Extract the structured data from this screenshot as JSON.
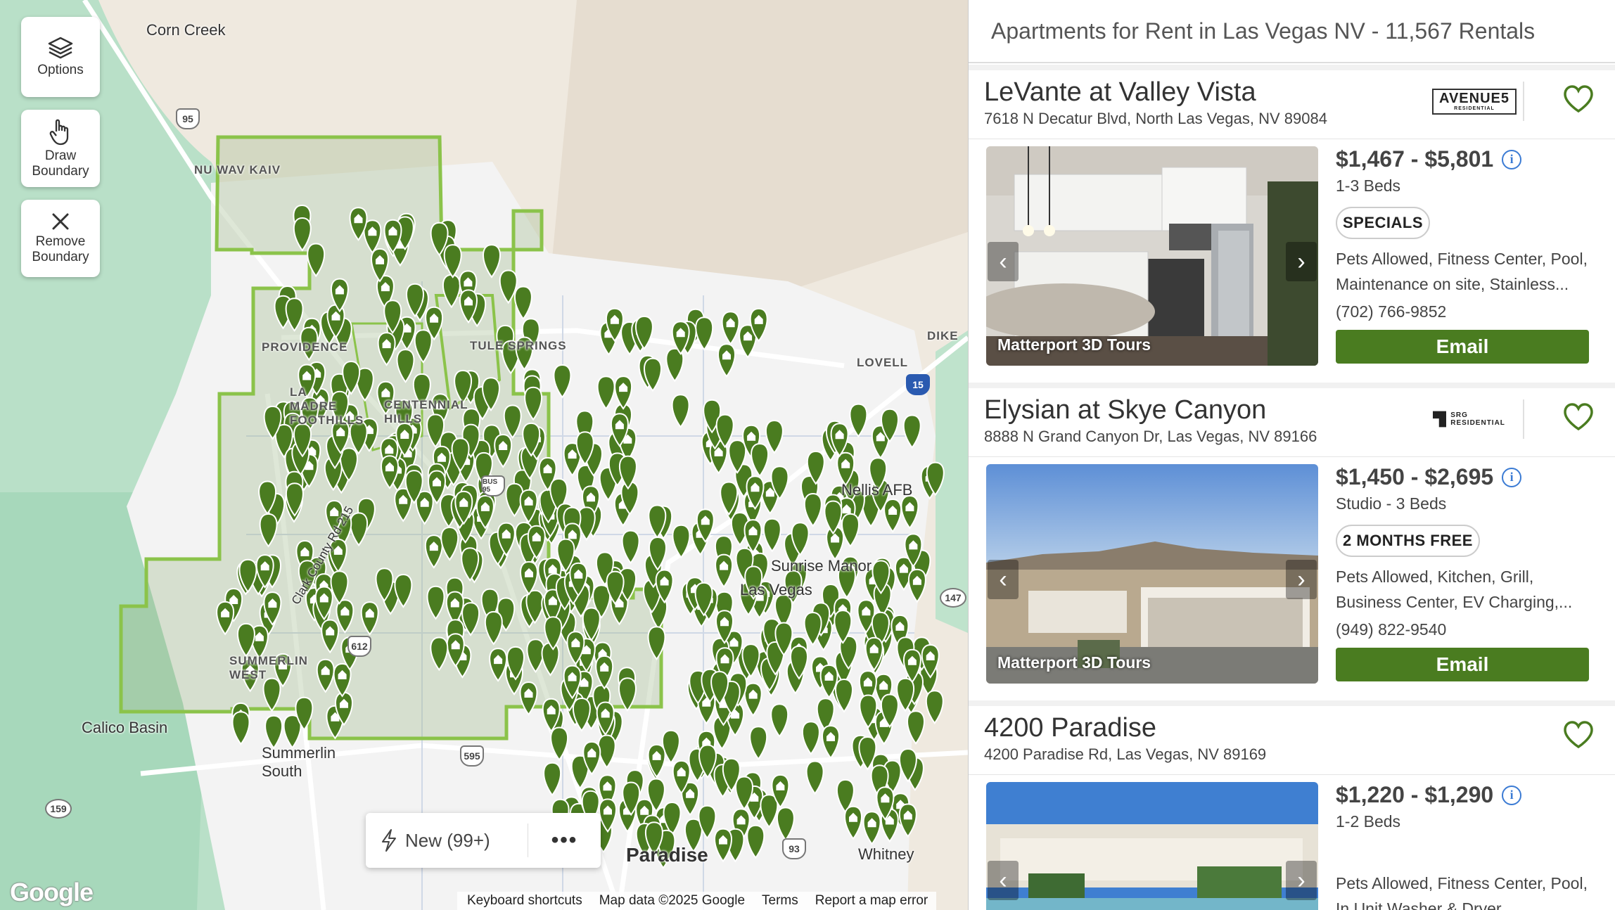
{
  "map": {
    "buttons": {
      "options": "Options",
      "draw_boundary": "Draw Boundary",
      "remove_boundary": "Remove Boundary"
    },
    "places": {
      "corn_creek": "Corn Creek",
      "nu_wav_kaiv": "NU WAV KAIV",
      "tule_springs": "TULE SPRINGS",
      "dike": "DIKE",
      "lovell": "LOVELL",
      "providence": "PROVIDENCE",
      "centennial": "CENTENNIAL HILLS",
      "la_madre": "LA MADRE FOOTHILLS",
      "nellis": "Nellis AFB",
      "sunrise_manor": "Sunrise Manor",
      "las_vegas": "Las Vegas",
      "calico_basin": "Calico Basin",
      "summerlin_west": "SUMMERLIN WEST",
      "summerlin_south": "Summerlin South",
      "paradise": "Paradise",
      "whitney": "Whitney",
      "clark_county": "Clark County Rd 215"
    },
    "highways": [
      "95",
      "15",
      "147",
      "159",
      "612",
      "595",
      "93",
      "BUS 95"
    ],
    "pill": {
      "new_label": "New (99+)",
      "more_label": "•••"
    },
    "google_logo": "Google",
    "footer": {
      "shortcuts": "Keyboard shortcuts",
      "map_data": "Map data ©2025 Google",
      "terms": "Terms",
      "report": "Report a map error"
    },
    "colors": {
      "boundary": "#8bc34a",
      "pin": "#4a7c20"
    }
  },
  "panel": {
    "heading": "Apartments for Rent in Las Vegas NV - 11,567 Rentals",
    "listings": [
      {
        "name": "LeVante at Valley Vista",
        "address": "7618 N Decatur Blvd, North Las Vegas, NV 89084",
        "logo": "AVENUE5",
        "logo_sub": "RESIDENTIAL",
        "price": "$1,467 - $5,801",
        "beds": "1-3 Beds",
        "badge": "SPECIALS",
        "amenities": "Pets Allowed, Fitness Center, Pool, Maintenance on site, Stainless...",
        "phone": "(702) 766-9852",
        "email": "Email",
        "tour": "Matterport 3D Tours"
      },
      {
        "name": "Elysian at Skye Canyon",
        "address": "8888 N Grand Canyon Dr, Las Vegas, NV 89166",
        "logo": "SRG RESIDENTIAL",
        "price": "$1,450 - $2,695",
        "beds": "Studio - 3 Beds",
        "badge": "2 MONTHS FREE",
        "amenities": "Pets Allowed, Kitchen, Grill, Business Center, EV Charging,...",
        "phone": "(949) 822-9540",
        "email": "Email",
        "tour": "Matterport 3D Tours"
      },
      {
        "name": "4200 Paradise",
        "address": "4200 Paradise Rd, Las Vegas, NV 89169",
        "price": "$1,220 - $1,290",
        "beds": "1-2 Beds",
        "amenities": "Pets Allowed, Fitness Center, Pool, In Unit Washer & Dryer,..."
      }
    ]
  }
}
